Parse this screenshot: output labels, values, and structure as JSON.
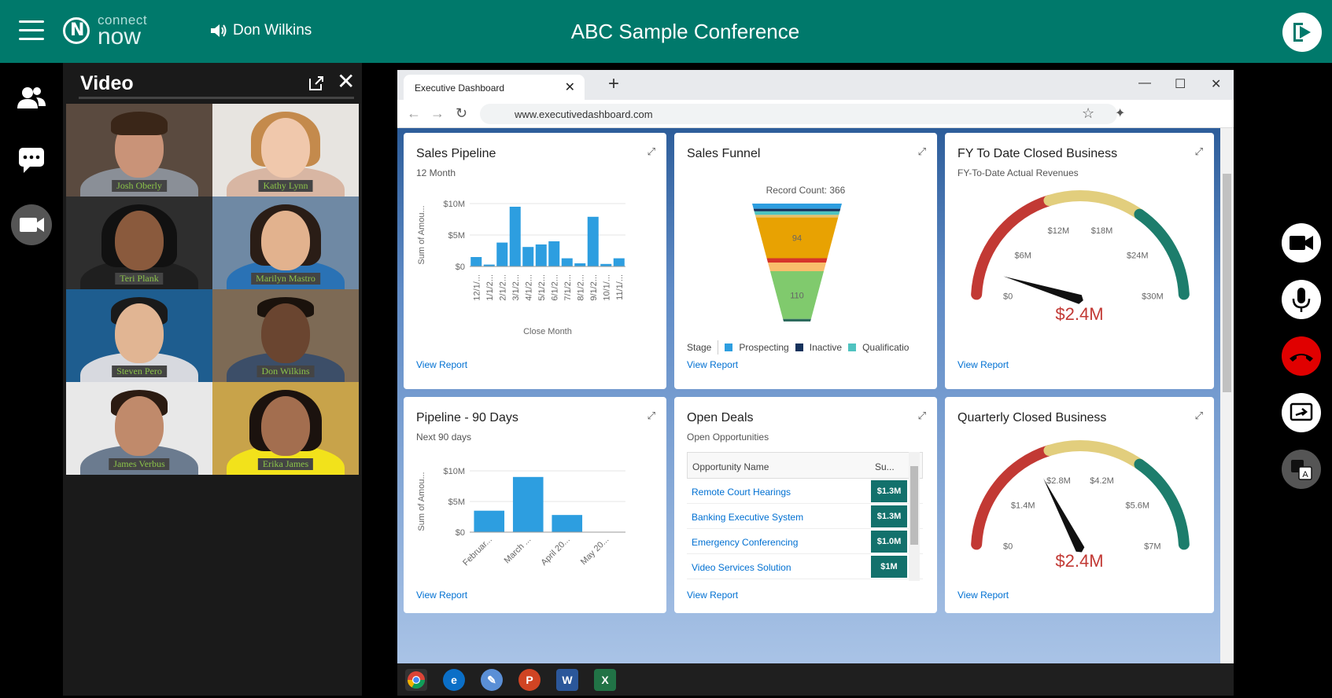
{
  "header": {
    "logo_top": "connect",
    "logo_bottom": "now",
    "speaker_name": "Don Wilkins",
    "conference_title": "ABC Sample Conference"
  },
  "video_panel": {
    "title": "Video",
    "participants": [
      "Josh Oberly",
      "Kathy Lynn",
      "Teri Plank",
      "Marilyn Mastro",
      "Steven Pero",
      "Don Wilkins",
      "James Verbus",
      "Erika James"
    ]
  },
  "browser": {
    "tab_title": "Executive Dashboard",
    "url": "www.executivedashboard.com"
  },
  "cards": {
    "sales_pipeline": {
      "title": "Sales Pipeline",
      "subtitle": "12 Month",
      "link": "View Report"
    },
    "sales_funnel": {
      "title": "Sales Funnel",
      "record_count": "Record Count: 366",
      "legend_title": "Stage",
      "legend": [
        "Prospecting",
        "Inactive",
        "Qualificatio"
      ],
      "link": "View Report"
    },
    "fy_closed": {
      "title": "FY To Date Closed Business",
      "subtitle": "FY-To-Date Actual Revenues",
      "value": "$2.4M",
      "link": "View Report"
    },
    "pipeline_90": {
      "title": "Pipeline - 90 Days",
      "subtitle": "Next 90 days",
      "link": "View Report"
    },
    "open_deals": {
      "title": "Open Deals",
      "subtitle": "Open Opportunities",
      "col_name": "Opportunity Name",
      "col_sum": "Su...",
      "rows": [
        {
          "name": "Remote Court Hearings",
          "value": "$1.3M"
        },
        {
          "name": "Banking Executive System",
          "value": "$1.3M"
        },
        {
          "name": "Emergency Conferencing",
          "value": "$1.0M"
        },
        {
          "name": "Video Services Solution",
          "value": "$1M"
        }
      ],
      "link": "View Report"
    },
    "quarterly": {
      "title": "Quarterly Closed Business",
      "value": "$2.4M",
      "link": "View Report"
    }
  },
  "chart_data": [
    {
      "type": "bar",
      "title": "Sales Pipeline",
      "xlabel": "Close Month",
      "ylabel": "Sum of Amou...",
      "ylim": [
        0,
        10
      ],
      "yticks": [
        "$0",
        "$5M",
        "$10M"
      ],
      "categories": [
        "12/1/...",
        "1/1/2...",
        "2/1/2...",
        "3/1/2...",
        "4/1/2...",
        "5/1/2...",
        "6/1/2...",
        "7/1/2...",
        "8/1/2...",
        "9/1/2...",
        "10/1/...",
        "11/1/..."
      ],
      "values": [
        1.5,
        0.3,
        3.8,
        9.5,
        3.1,
        3.5,
        4.0,
        1.3,
        0.5,
        7.9,
        0.4,
        1.3
      ],
      "color": "#2d9ee0"
    },
    {
      "type": "bar",
      "title": "Pipeline - 90 Days",
      "ylabel": "Sum of Amou...",
      "ylim": [
        0,
        10
      ],
      "yticks": [
        "$0",
        "$5M",
        "$10M"
      ],
      "categories": [
        "Februar...",
        "March ...",
        "April 20...",
        "May 20..."
      ],
      "values": [
        3.5,
        9.0,
        2.8,
        0
      ],
      "color": "#2d9ee0"
    },
    {
      "type": "funnel",
      "title": "Sales Funnel",
      "segments": [
        {
          "value": 12,
          "color": "#2d9ee0"
        },
        {
          "value": 6,
          "color": "#16325c"
        },
        {
          "value": 8,
          "color": "#4fc3c0"
        },
        {
          "value": 6,
          "color": "#e8c06b"
        },
        {
          "value": 94,
          "color": "#e8a202",
          "label": "94"
        },
        {
          "value": 10,
          "color": "#d6352b"
        },
        {
          "value": 20,
          "color": "#f9be6c"
        },
        {
          "value": 110,
          "color": "#80ca6d",
          "label": "110"
        },
        {
          "value": 6,
          "color": "#2d6b5d"
        }
      ]
    },
    {
      "type": "gauge",
      "title": "FY To Date Closed Business",
      "min": 0,
      "max": 30,
      "ticks": [
        "$0",
        "$6M",
        "$12M",
        "$18M",
        "$24M",
        "$30M"
      ],
      "value": 2.4,
      "bands": [
        {
          "to": 12,
          "color": "#c23934"
        },
        {
          "to": 21,
          "color": "#e2ce7d"
        },
        {
          "to": 30,
          "color": "#1d7d6c"
        }
      ]
    },
    {
      "type": "gauge",
      "title": "Quarterly Closed Business",
      "min": 0,
      "max": 7,
      "ticks": [
        "$0",
        "$1.4M",
        "$2.8M",
        "$4.2M",
        "$5.6M",
        "$7M"
      ],
      "value": 2.4,
      "bands": [
        {
          "to": 2.8,
          "color": "#c23934"
        },
        {
          "to": 4.9,
          "color": "#e2ce7d"
        },
        {
          "to": 7,
          "color": "#1d7d6c"
        }
      ]
    }
  ],
  "taskbar": [
    "chrome-icon",
    "edge-icon",
    "paint-icon",
    "powerpoint-icon",
    "word-icon",
    "excel-icon"
  ]
}
